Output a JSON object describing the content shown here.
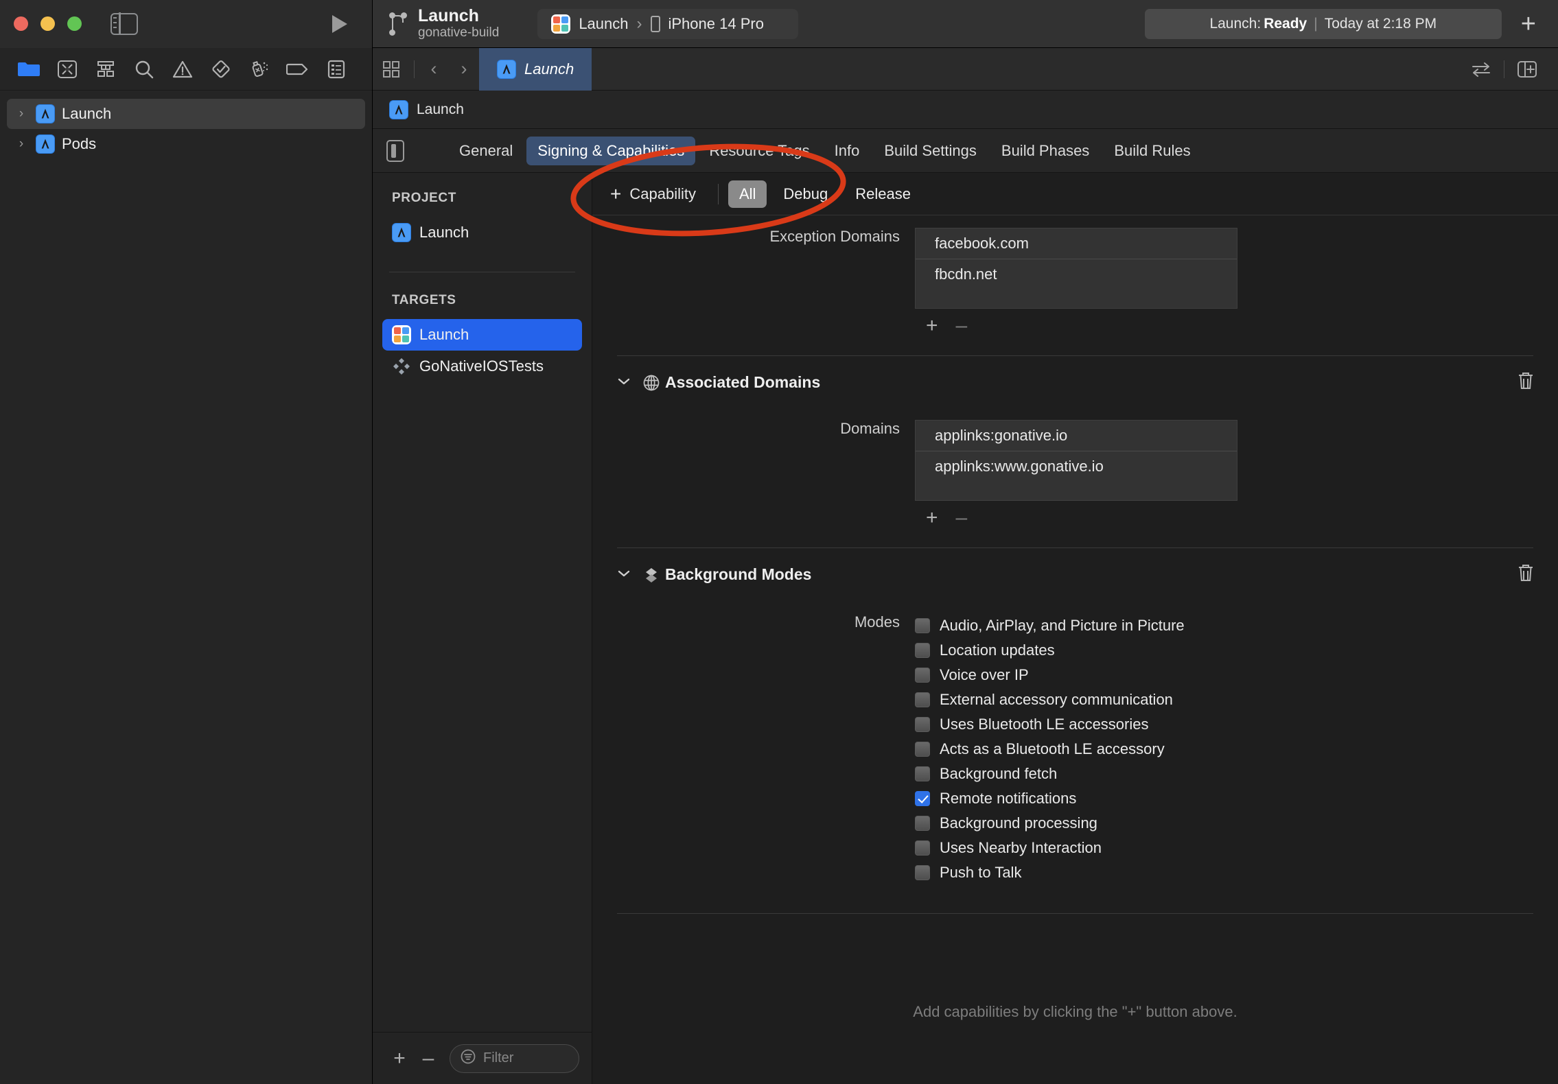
{
  "window": {
    "traffic_lights": [
      "close",
      "minimize",
      "zoom"
    ],
    "sidebar_toggle_icon": "sidebar-toggle-icon",
    "run_icon": "run-play-icon",
    "project_title": "Launch",
    "project_subtitle": "gonative-build",
    "branch_icon": "source-control-branch-icon",
    "scheme": {
      "app_icon": "app-grid-icon",
      "name": "Launch",
      "separator": "›",
      "device_icon": "iphone-icon",
      "device": "iPhone 14 Pro"
    },
    "status": {
      "prefix": "Launch:",
      "state": "Ready",
      "divider": "|",
      "time": "Today at 2:18 PM"
    },
    "add_button": "+"
  },
  "navigator": {
    "toolbar_icons": [
      "project-navigator-icon",
      "source-control-navigator-icon",
      "hierarchy-navigator-icon",
      "find-navigator-icon",
      "issue-navigator-icon",
      "test-navigator-icon",
      "debug-navigator-icon",
      "breakpoint-navigator-icon",
      "report-navigator-icon"
    ],
    "items": [
      {
        "label": "Launch",
        "icon": "xcode-project-icon",
        "disclosure": "›",
        "selected": true
      },
      {
        "label": "Pods",
        "icon": "xcode-project-icon",
        "disclosure": "›",
        "selected": false
      }
    ]
  },
  "editor": {
    "tabbar": {
      "grid_icon": "tab-grid-icon",
      "back_arrow": "‹",
      "forward_arrow": "›",
      "tab": {
        "icon": "xcode-project-icon",
        "label": "Launch"
      },
      "swap_icon": "swap-editors-icon",
      "add_editor_icon": "add-editor-icon"
    },
    "breadcrumb": {
      "icon": "xcode-project-icon",
      "label": "Launch"
    },
    "inspector_toggle_icon": "inspector-toggle-icon",
    "tabs": [
      {
        "label": "General",
        "active": false
      },
      {
        "label": "Signing & Capabilities",
        "active": true
      },
      {
        "label": "Resource Tags",
        "active": false
      },
      {
        "label": "Info",
        "active": false
      },
      {
        "label": "Build Settings",
        "active": false
      },
      {
        "label": "Build Phases",
        "active": false
      },
      {
        "label": "Build Rules",
        "active": false
      }
    ]
  },
  "targets_pane": {
    "project_group": "PROJECT",
    "project_items": [
      {
        "label": "Launch",
        "icon": "xcode-project-icon"
      }
    ],
    "targets_group": "TARGETS",
    "target_items": [
      {
        "label": "Launch",
        "icon": "app-grid-icon",
        "selected": true
      },
      {
        "label": "GoNativeIOSTests",
        "icon": "test-bundle-icon",
        "selected": false
      }
    ],
    "footer": {
      "add": "+",
      "remove": "–",
      "filter_icon": "filter-icon",
      "filter_placeholder": "Filter"
    }
  },
  "capabilities": {
    "toolbar": {
      "add_plus": "+",
      "add_label": "Capability",
      "configs": [
        {
          "label": "All",
          "selected": true
        },
        {
          "label": "Debug",
          "selected": false
        },
        {
          "label": "Release",
          "selected": false
        }
      ]
    },
    "exception_domains": {
      "label": "Exception Domains",
      "items": [
        "facebook.com",
        "fbcdn.net"
      ],
      "add": "+",
      "remove": "–"
    },
    "sections": [
      {
        "title": "Associated Domains",
        "icon": "globe-icon",
        "caret": "⌄",
        "delete_icon": "trash-icon",
        "field_label": "Domains",
        "items": [
          "applinks:gonative.io",
          "applinks:www.gonative.io"
        ],
        "add": "+",
        "remove": "–"
      },
      {
        "title": "Background Modes",
        "icon": "layers-icon",
        "caret": "⌄",
        "delete_icon": "trash-icon",
        "field_label": "Modes",
        "modes": [
          {
            "label": "Audio, AirPlay, and Picture in Picture",
            "checked": false
          },
          {
            "label": "Location updates",
            "checked": false
          },
          {
            "label": "Voice over IP",
            "checked": false
          },
          {
            "label": "External accessory communication",
            "checked": false
          },
          {
            "label": "Uses Bluetooth LE accessories",
            "checked": false
          },
          {
            "label": "Acts as a Bluetooth LE accessory",
            "checked": false
          },
          {
            "label": "Background fetch",
            "checked": false
          },
          {
            "label": "Remote notifications",
            "checked": true
          },
          {
            "label": "Background processing",
            "checked": false
          },
          {
            "label": "Uses Nearby Interaction",
            "checked": false
          },
          {
            "label": "Push to Talk",
            "checked": false
          }
        ]
      }
    ],
    "hint": "Add capabilities by clicking the \"+\" button above."
  },
  "annotation": {
    "shape": "ellipse",
    "color": "#d93a18",
    "target": "+ Capability"
  },
  "colors": {
    "accent_blue": "#2563eb",
    "tab_active": "#3b5173",
    "window_bg": "#1e1e1e",
    "titlebar": "#323232",
    "checkbox_on": "#2f72e8",
    "annotation_red": "#d93a18"
  }
}
